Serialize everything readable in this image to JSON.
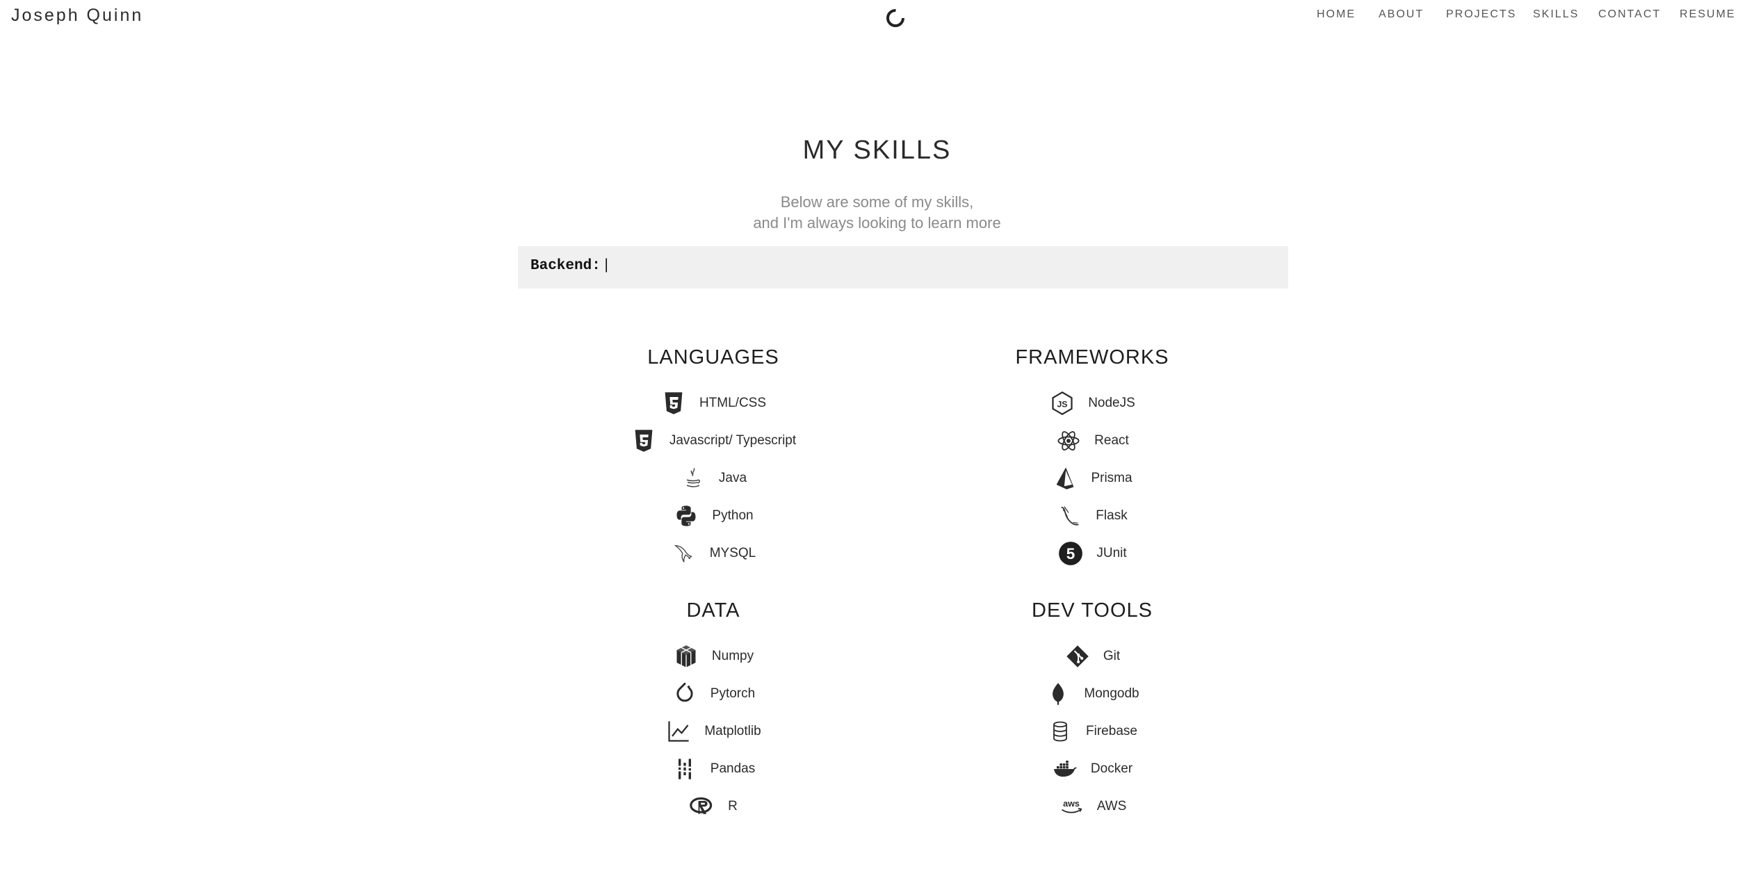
{
  "header": {
    "brand": "Joseph Quinn",
    "nav": [
      "HOME",
      "ABOUT",
      "PROJECTS",
      "SKILLS",
      "CONTACT",
      "RESUME"
    ]
  },
  "main": {
    "title": "MY SKILLS",
    "subtitle_line1": "Below are some of my skills,",
    "subtitle_line2": "and I'm always looking to learn more",
    "typewriter": {
      "text": "Backend:",
      "caret": "|"
    }
  },
  "sections": {
    "languages": {
      "title": "LANGUAGES",
      "items": [
        {
          "label": "HTML/CSS",
          "icon": "html5-icon"
        },
        {
          "label": "Javascript/ Typescript",
          "icon": "html5-icon"
        },
        {
          "label": "Java",
          "icon": "java-icon"
        },
        {
          "label": "Python",
          "icon": "python-icon"
        },
        {
          "label": "MYSQL",
          "icon": "mysql-icon"
        }
      ]
    },
    "frameworks": {
      "title": "FRAMEWORKS",
      "items": [
        {
          "label": "NodeJS",
          "icon": "nodejs-icon"
        },
        {
          "label": "React",
          "icon": "react-icon"
        },
        {
          "label": "Prisma",
          "icon": "prisma-icon"
        },
        {
          "label": "Flask",
          "icon": "flask-icon"
        },
        {
          "label": "JUnit",
          "icon": "junit-icon"
        }
      ]
    },
    "data": {
      "title": "DATA",
      "items": [
        {
          "label": "Numpy",
          "icon": "numpy-icon"
        },
        {
          "label": "Pytorch",
          "icon": "pytorch-icon"
        },
        {
          "label": "Matplotlib",
          "icon": "chart-line-icon"
        },
        {
          "label": "Pandas",
          "icon": "pandas-icon"
        },
        {
          "label": "R",
          "icon": "r-icon"
        }
      ]
    },
    "devtools": {
      "title": "DEV TOOLS",
      "items": [
        {
          "label": "Git",
          "icon": "git-icon"
        },
        {
          "label": "Mongodb",
          "icon": "mongodb-icon"
        },
        {
          "label": "Firebase",
          "icon": "firebase-icon"
        },
        {
          "label": "Docker",
          "icon": "docker-icon"
        },
        {
          "label": "AWS",
          "icon": "aws-icon"
        }
      ]
    }
  }
}
